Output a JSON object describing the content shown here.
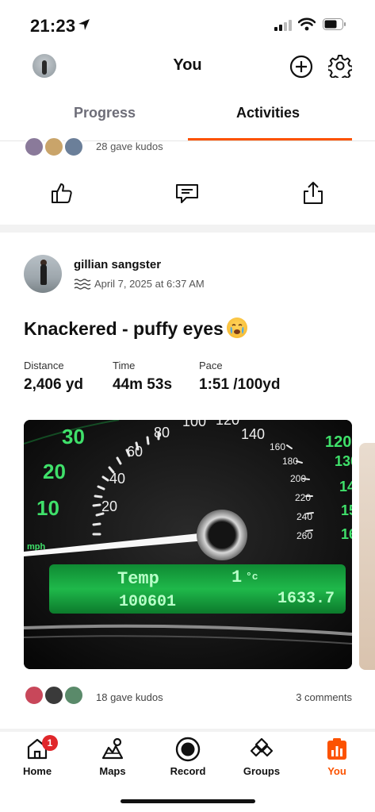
{
  "status_bar": {
    "time": "21:23"
  },
  "header": {
    "title": "You"
  },
  "tabs": [
    {
      "label": "Progress"
    },
    {
      "label": "Activities",
      "active": true
    }
  ],
  "previous_activity": {
    "kudos_text": "28 gave kudos"
  },
  "activity": {
    "athlete": "gillian sangster",
    "date": "April 7, 2025 at 6:37 AM",
    "title": "Knackered - puffy eyes",
    "title_emoji": "crying-face",
    "stats": [
      {
        "label": "Distance",
        "value": "2,406 yd"
      },
      {
        "label": "Time",
        "value": "44m 53s"
      },
      {
        "label": "Pace",
        "value": "1:51 /100yd"
      }
    ],
    "photo": {
      "speedo_labels": [
        "10",
        "20",
        "30",
        "20",
        "40",
        "60",
        "80",
        "100",
        "120",
        "140",
        "160",
        "180",
        "200",
        "220",
        "240",
        "260",
        "120",
        "130",
        "14",
        "15",
        "16"
      ],
      "display_temp_label": "Temp",
      "display_temp_value": "1",
      "display_unit": "°c",
      "display_odometer": "100601",
      "display_trip": "1633.7",
      "mph_label": "mph"
    },
    "kudos_text": "18 gave kudos",
    "comments_text": "3 comments"
  },
  "bottom_nav": [
    {
      "label": "Home",
      "icon": "home-icon",
      "badge": "1"
    },
    {
      "label": "Maps",
      "icon": "maps-icon"
    },
    {
      "label": "Record",
      "icon": "record-icon"
    },
    {
      "label": "Groups",
      "icon": "groups-icon"
    },
    {
      "label": "You",
      "icon": "you-icon",
      "active": true
    }
  ],
  "colors": {
    "accent": "#fc5200",
    "badge": "#e0262a",
    "text": "#111111",
    "muted": "#6d6d78",
    "dash_green": "#2ad15a"
  }
}
